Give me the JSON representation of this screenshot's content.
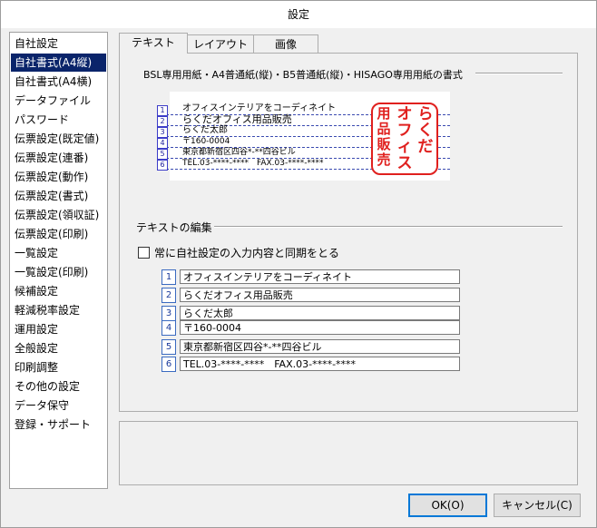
{
  "window": {
    "title": "設定"
  },
  "sidebar": {
    "items": [
      {
        "label": "自社設定"
      },
      {
        "label": "自社書式(A4縦)"
      },
      {
        "label": "自社書式(A4横)"
      },
      {
        "label": "データファイル"
      },
      {
        "label": "パスワード"
      },
      {
        "label": "伝票設定(既定値)"
      },
      {
        "label": "伝票設定(連番)"
      },
      {
        "label": "伝票設定(動作)"
      },
      {
        "label": "伝票設定(書式)"
      },
      {
        "label": "伝票設定(領収証)"
      },
      {
        "label": "伝票設定(印刷)"
      },
      {
        "label": "一覧設定"
      },
      {
        "label": "一覧設定(印刷)"
      },
      {
        "label": "候補設定"
      },
      {
        "label": "軽減税率設定"
      },
      {
        "label": "運用設定"
      },
      {
        "label": "全般設定"
      },
      {
        "label": "印刷調整"
      },
      {
        "label": "その他の設定"
      },
      {
        "label": "データ保守"
      },
      {
        "label": "登録・サポート"
      }
    ],
    "selected_index": 1
  },
  "tabs": [
    {
      "label": "テキスト",
      "active": true
    },
    {
      "label": "レイアウト",
      "active": false
    },
    {
      "label": "画像",
      "active": false
    }
  ],
  "preview_group": {
    "title": "BSL専用用紙・A4普通紙(縦)・B5普通紙(縦)・HISAGO専用用紙の書式",
    "lines": [
      {
        "num": "1",
        "text": "オフィスインテリアをコーディネイト"
      },
      {
        "num": "2",
        "text": "らくだオフィス用品販売"
      },
      {
        "num": "3",
        "text": "らくだ太郎"
      },
      {
        "num": "4",
        "text": "〒160-0004"
      },
      {
        "num": "5",
        "text": "東京都新宿区四谷*-**四谷ビル"
      },
      {
        "num": "6",
        "text": "TEL.03-****-****　FAX.03-****-****"
      }
    ],
    "stamp": {
      "columns": [
        "らくだ",
        "オフィス",
        "用品販売"
      ],
      "color": "#e0201e"
    }
  },
  "edit_group": {
    "title": "テキストの編集",
    "sync_checkbox": {
      "label": "常に自社設定の入力内容と同期をとる",
      "checked": false
    },
    "fields": [
      {
        "num": "1",
        "value": "オフィスインテリアをコーディネイト"
      },
      {
        "num": "2",
        "value": "らくだオフィス用品販売"
      },
      {
        "num": "3",
        "value": "らくだ太郎"
      },
      {
        "num": "4",
        "value": "〒160-0004"
      },
      {
        "num": "5",
        "value": "東京都新宿区四谷*-**四谷ビル"
      },
      {
        "num": "6",
        "value": "TEL.03-****-****　FAX.03-****-****"
      }
    ]
  },
  "buttons": {
    "ok": "OK(O)",
    "cancel": "キャンセル(C)"
  },
  "colors": {
    "selection": "#0a246a",
    "stamp": "#e0201e",
    "default_button_border": "#0078d7"
  }
}
